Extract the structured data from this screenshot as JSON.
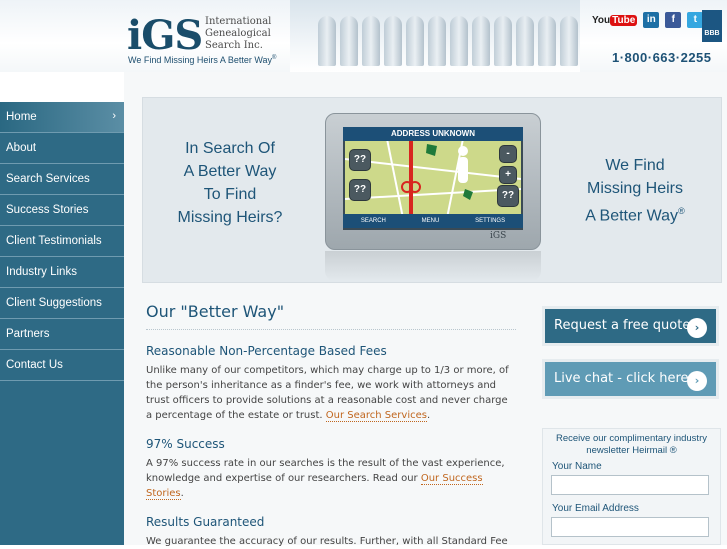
{
  "header": {
    "logo": "iGS",
    "org_name_line1": "International",
    "org_name_line2": "Genealogical",
    "org_name_line3": "Search Inc.",
    "tagline": "We Find Missing Heirs A Better Way",
    "tagline_mark": "®",
    "phone": "1·800·663·2255",
    "social": {
      "youtube_you": "You",
      "youtube_tube": "Tube",
      "linkedin": "in",
      "facebook": "f",
      "twitter": "t",
      "bbb": "BBB"
    }
  },
  "nav": {
    "items": [
      {
        "label": "Home",
        "active": true
      },
      {
        "label": "About"
      },
      {
        "label": "Search Services"
      },
      {
        "label": "Success Stories"
      },
      {
        "label": "Client Testimonials"
      },
      {
        "label": "Industry Links"
      },
      {
        "label": "Client Suggestions"
      },
      {
        "label": "Partners"
      },
      {
        "label": "Contact Us"
      }
    ],
    "active_chevron": "›"
  },
  "banner": {
    "left_text": [
      "In Search Of",
      "A Better Way",
      "To Find",
      "Missing Heirs?"
    ],
    "right_text": [
      "We Find",
      "Missing Heirs",
      "A Better Way"
    ],
    "right_mark": "®",
    "gps": {
      "title": "ADDRESS UNKNOWN",
      "btn_q1": "??",
      "btn_q2": "??",
      "btn_q3": "??",
      "btn_minus": "-",
      "btn_plus": "+",
      "menu_search": "SEARCH",
      "menu_menu": "MENU",
      "menu_settings": "SETTINGS",
      "brand": "iGS"
    }
  },
  "content": {
    "title": "Our \"Better Way\"",
    "sections": [
      {
        "heading": "Reasonable Non-Percentage Based Fees",
        "body": "Unlike many of our competitors, which may charge up to 1/3 or more, of the person's inheritance as a finder's fee, we work with attorneys and trust officers to provide solutions at a reasonable cost and never charge a percentage of the estate or trust. ",
        "link": "Our Search Services",
        "after": "."
      },
      {
        "heading": "97% Success",
        "body": "A 97% success rate in our searches is the result of the vast experience, knowledge and expertise of our researchers. Read our ",
        "link": "Our Success Stories",
        "after": "."
      },
      {
        "heading": "Results Guaranteed",
        "body": "We guarantee the accuracy of our results. Further, with all Standard Fee"
      }
    ]
  },
  "sidebar": {
    "cta_quote": "Request a free quote",
    "cta_chat": "Live chat - click here",
    "cta_arrow": "›",
    "newsletter_title_1": "Receive our complimentary industry",
    "newsletter_title_2": "newsletter Heirmail",
    "newsletter_mark": "®",
    "name_label": "Your Name",
    "email_label": "Your Email Address"
  },
  "colors": {
    "nav_bg": "#2e6a85",
    "heading": "#1e5578",
    "link": "#c0661e"
  }
}
